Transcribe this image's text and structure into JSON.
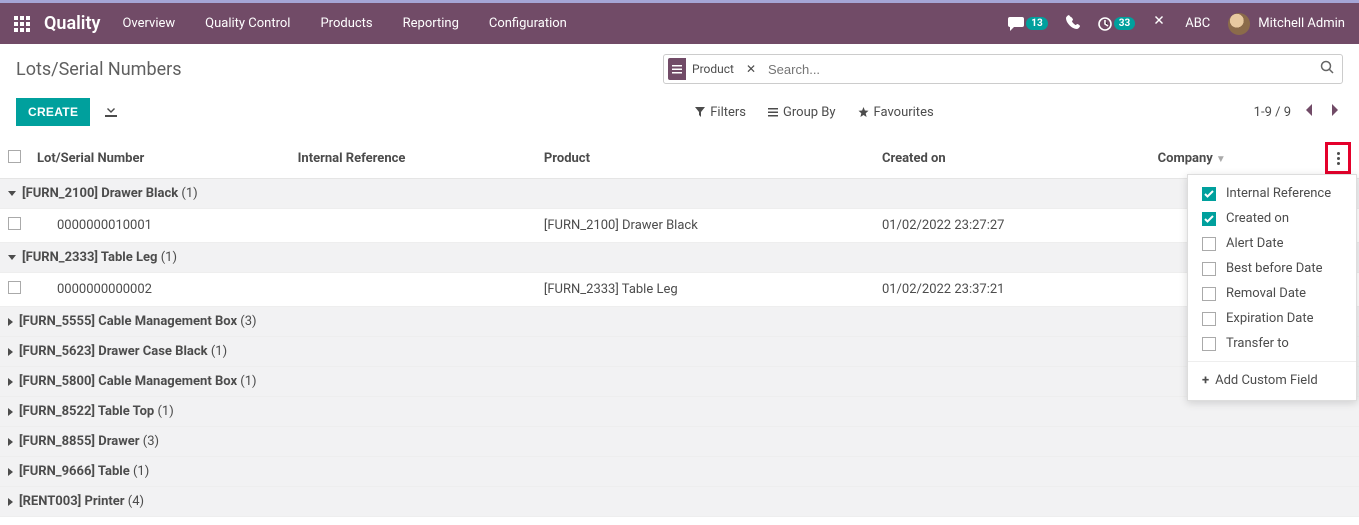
{
  "header": {
    "app_name": "Quality",
    "menus": [
      "Overview",
      "Quality Control",
      "Products",
      "Reporting",
      "Configuration"
    ],
    "chat_badge": "13",
    "activity_badge": "33",
    "company": "ABC",
    "user_name": "Mitchell Admin"
  },
  "cp": {
    "title": "Lots/Serial Numbers",
    "facet_label": "Product",
    "search_placeholder": "Search...",
    "create_label": "CREATE",
    "filters_label": "Filters",
    "groupby_label": "Group By",
    "favourites_label": "Favourites",
    "pager": "1-9 / 9"
  },
  "table": {
    "columns": {
      "lot": "Lot/Serial Number",
      "ref": "Internal Reference",
      "product": "Product",
      "created": "Created on",
      "company": "Company"
    },
    "groups": [
      {
        "label": "[FURN_2100] Drawer Black",
        "count": "(1)",
        "expanded": true,
        "rows": [
          {
            "lot": "0000000010001",
            "ref": "",
            "product": "[FURN_2100] Drawer Black",
            "created": "01/02/2022 23:27:27"
          }
        ]
      },
      {
        "label": "[FURN_2333] Table Leg",
        "count": "(1)",
        "expanded": true,
        "rows": [
          {
            "lot": "0000000000002",
            "ref": "",
            "product": "[FURN_2333] Table Leg",
            "created": "01/02/2022 23:37:21"
          }
        ]
      },
      {
        "label": "[FURN_5555] Cable Management Box",
        "count": "(3)",
        "expanded": false,
        "rows": []
      },
      {
        "label": "[FURN_5623] Drawer Case Black",
        "count": "(1)",
        "expanded": false,
        "rows": []
      },
      {
        "label": "[FURN_5800] Cable Management Box",
        "count": "(1)",
        "expanded": false,
        "rows": []
      },
      {
        "label": "[FURN_8522] Table Top",
        "count": "(1)",
        "expanded": false,
        "rows": []
      },
      {
        "label": "[FURN_8855] Drawer",
        "count": "(3)",
        "expanded": false,
        "rows": []
      },
      {
        "label": "[FURN_9666] Table",
        "count": "(1)",
        "expanded": false,
        "rows": []
      },
      {
        "label": "[RENT003] Printer",
        "count": "(4)",
        "expanded": false,
        "rows": []
      }
    ]
  },
  "dropdown": {
    "items": [
      {
        "label": "Internal Reference",
        "checked": true
      },
      {
        "label": "Created on",
        "checked": true
      },
      {
        "label": "Alert Date",
        "checked": false
      },
      {
        "label": "Best before Date",
        "checked": false
      },
      {
        "label": "Removal Date",
        "checked": false
      },
      {
        "label": "Expiration Date",
        "checked": false
      },
      {
        "label": "Transfer to",
        "checked": false
      }
    ],
    "add_custom": "Add Custom Field"
  }
}
